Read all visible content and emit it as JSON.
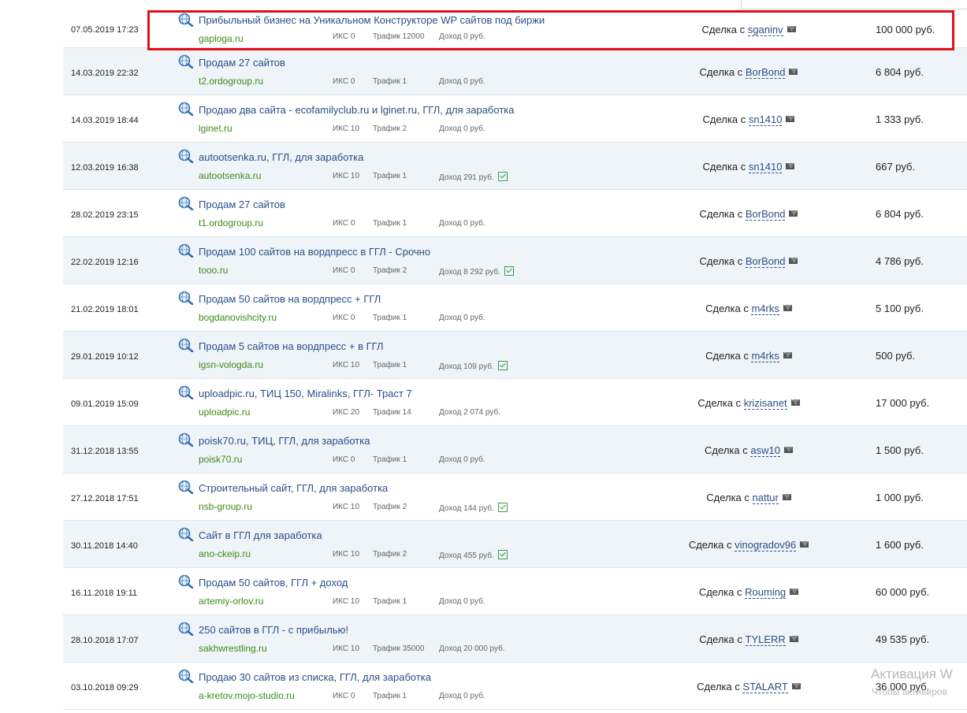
{
  "rows": [
    {
      "date": "07.05.2019 17:23",
      "title": "Прибыльный бизнес на Уникальном Конструкторе WP сайтов под биржи",
      "site": "gaploga.ru",
      "iks": "ИКС 0",
      "traffic": "Трафик 12000",
      "income": "Доход 0 руб.",
      "verified": false,
      "deal_prefix": "Сделка с",
      "user": "sganinv",
      "price": "100 000 руб."
    },
    {
      "date": "14.03.2019 22:32",
      "title": "Продам 27 сайтов",
      "site": "t2.ordogroup.ru",
      "iks": "ИКС 0",
      "traffic": "Трафик 1",
      "income": "Доход 0 руб.",
      "verified": false,
      "deal_prefix": "Сделка с",
      "user": "BorBond",
      "price": "6 804 руб."
    },
    {
      "date": "14.03.2019 18:44",
      "title": "Продаю два сайта - ecofamilyclub.ru и lginet.ru, ГГЛ, для заработка",
      "site": "lginet.ru",
      "iks": "ИКС 10",
      "traffic": "Трафик 2",
      "income": "Доход 0 руб.",
      "verified": false,
      "deal_prefix": "Сделка с",
      "user": "sn1410",
      "price": "1 333 руб."
    },
    {
      "date": "12.03.2019 16:38",
      "title": "autootsenka.ru, ГГЛ, для заработка",
      "site": "autootsenka.ru",
      "iks": "ИКС 10",
      "traffic": "Трафик 1",
      "income": "Доход 291 руб.",
      "verified": true,
      "deal_prefix": "Сделка с",
      "user": "sn1410",
      "price": "667 руб."
    },
    {
      "date": "28.02.2019 23:15",
      "title": "Продам 27 сайтов",
      "site": "t1.ordogroup.ru",
      "iks": "ИКС 0",
      "traffic": "Трафик 1",
      "income": "Доход 0 руб.",
      "verified": false,
      "deal_prefix": "Сделка с",
      "user": "BorBond",
      "price": "6 804 руб."
    },
    {
      "date": "22.02.2019 12:16",
      "title": "Продам 100 сайтов на вордпресс в ГГЛ - Срочно",
      "site": "tooo.ru",
      "iks": "ИКС 0",
      "traffic": "Трафик 2",
      "income": "Доход 8 292 руб.",
      "verified": true,
      "deal_prefix": "Сделка с",
      "user": "BorBond",
      "price": "4 786 руб."
    },
    {
      "date": "21.02.2019 18:01",
      "title": "Продам 50 сайтов на вордпресс + ГГЛ",
      "site": "bogdanovishcity.ru",
      "iks": "ИКС 0",
      "traffic": "Трафик 1",
      "income": "Доход 0 руб.",
      "verified": false,
      "deal_prefix": "Сделка с",
      "user": "m4rks",
      "price": "5 100 руб."
    },
    {
      "date": "29.01.2019 10:12",
      "title": "Продам 5 сайтов на вордпресс + в ГГЛ",
      "site": "igsn-vologda.ru",
      "iks": "ИКС 10",
      "traffic": "Трафик 1",
      "income": "Доход 109 руб.",
      "verified": true,
      "deal_prefix": "Сделка с",
      "user": "m4rks",
      "price": "500 руб."
    },
    {
      "date": "09.01.2019 15:09",
      "title": "uploadpic.ru, ТИЦ 150, Miralinks, ГГЛ- Траст 7",
      "site": "uploadpic.ru",
      "iks": "ИКС 20",
      "traffic": "Трафик 14",
      "income": "Доход 2 074 руб.",
      "verified": false,
      "deal_prefix": "Сделка с",
      "user": "krizisanet",
      "price": "17 000 руб."
    },
    {
      "date": "31.12.2018 13:55",
      "title": "poisk70.ru, ТИЦ, ГГЛ, для заработка",
      "site": "poisk70.ru",
      "iks": "ИКС 0",
      "traffic": "Трафик 1",
      "income": "Доход 0 руб.",
      "verified": false,
      "deal_prefix": "Сделка с",
      "user": "asw10",
      "price": "1 500 руб."
    },
    {
      "date": "27.12.2018 17:51",
      "title": "Строительный сайт, ГГЛ, для заработка",
      "site": "nsb-group.ru",
      "iks": "ИКС 10",
      "traffic": "Трафик 2",
      "income": "Доход 144 руб.",
      "verified": true,
      "deal_prefix": "Сделка с",
      "user": "nattur",
      "price": "1 000 руб."
    },
    {
      "date": "30.11.2018 14:40",
      "title": "Сайт в ГГЛ для заработка",
      "site": "ano-ckeip.ru",
      "iks": "ИКС 10",
      "traffic": "Трафик 2",
      "income": "Доход 455 руб.",
      "verified": true,
      "deal_prefix": "Сделка с",
      "user": "vinogradov96",
      "price": "1 600 руб."
    },
    {
      "date": "16.11.2018 19:11",
      "title": "Продам 50 сайтов, ГГЛ + доход",
      "site": "artemiy-orlov.ru",
      "iks": "ИКС 10",
      "traffic": "Трафик 1",
      "income": "Доход 0 руб.",
      "verified": false,
      "deal_prefix": "Сделка с",
      "user": "Rouming",
      "price": "60 000 руб."
    },
    {
      "date": "28.10.2018 17:07",
      "title": "250 сайтов в ГГЛ - с прибылью!",
      "site": "sakhwrestling.ru",
      "iks": "ИКС 10",
      "traffic": "Трафик 35000",
      "income": "Доход 20 000 руб.",
      "verified": false,
      "deal_prefix": "Сделка с",
      "user": "TYLERR",
      "price": "49 535 руб."
    },
    {
      "date": "03.10.2018 09:29",
      "title": "Продаю 30 сайтов из списка, ГГЛ, для заработка",
      "site": "a-kretov.mojo-studio.ru",
      "iks": "ИКС 0",
      "traffic": "Трафик 1",
      "income": "Доход 0 руб.",
      "verified": false,
      "deal_prefix": "Сделка с",
      "user": "STALART",
      "price": "36 000 руб."
    }
  ],
  "watermark": {
    "line1": "Активация W",
    "line2": "Чтобы активиров"
  },
  "colors": {
    "link": "#2a4f86",
    "site": "#3d8b1a",
    "alt_row": "#eef4f8",
    "highlight": "#e0101a"
  },
  "icons": {
    "row": "magnifier-globe-icon",
    "mail": "envelope-icon",
    "verified": "check-box-icon"
  }
}
